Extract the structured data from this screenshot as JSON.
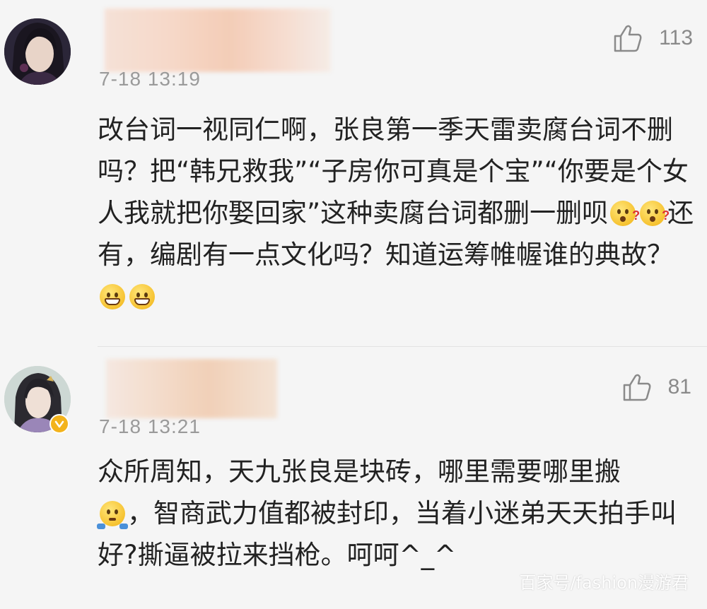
{
  "comments": [
    {
      "time": "7-18 13:19",
      "likes": "113",
      "text_parts": [
        "改台词一视同仁啊，张良第一季天雷卖腐台词不删吗？把“韩兄救我”“子房你可真是个宝”“你要是个女人我就把你娶回家”这种卖腐台词都删一删呗",
        "还有，编剧有一点文化吗？知道运筹帷幄谁的典故？"
      ],
      "emojis": [
        "confused-emoji",
        "confused-emoji",
        "grin-emoji",
        "grin-emoji"
      ]
    },
    {
      "time": "7-18 13:21",
      "likes": "81",
      "text_parts": [
        "众所周知，天九张良是块砖，哪里需要哪里搬",
        "，智商武力值都被封印，当着小迷弟天天拍手叫好?撕逼被拉来挡枪。呵呵^_^"
      ],
      "emojis": [
        "shrug-emoji"
      ],
      "verified": true
    }
  ],
  "watermark": "百家号/fashion漫游君",
  "colors": {
    "background": "#f5f5f5",
    "text": "#222222",
    "meta": "#9a9a9a",
    "verified_badge": "#f3b31c"
  },
  "icons": [
    "thumbs-up-icon",
    "verified-badge-icon"
  ]
}
